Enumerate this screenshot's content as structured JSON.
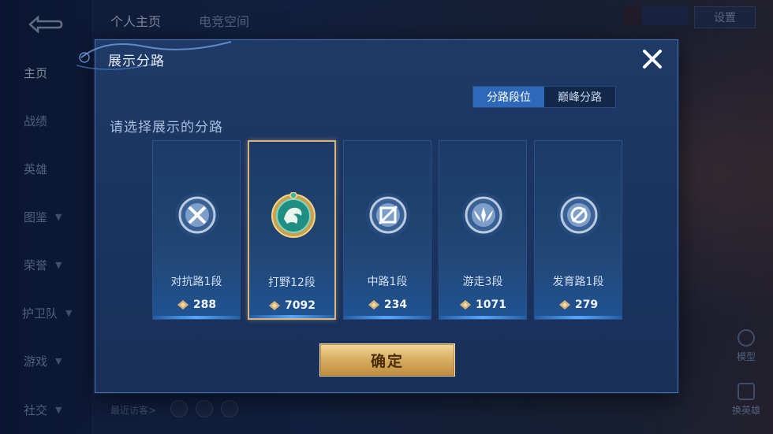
{
  "background": {
    "sidebar": {
      "items": [
        {
          "label": "主页",
          "chevron": false,
          "active": true
        },
        {
          "label": "战绩",
          "chevron": false,
          "active": false
        },
        {
          "label": "英雄",
          "chevron": false,
          "active": false
        },
        {
          "label": "图鉴",
          "chevron": true,
          "active": false
        },
        {
          "label": "荣誉",
          "chevron": true,
          "active": false
        },
        {
          "label": "护卫队",
          "chevron": true,
          "active": false
        },
        {
          "label": "游戏",
          "chevron": true,
          "active": false
        },
        {
          "label": "社交",
          "chevron": true,
          "active": false
        }
      ]
    },
    "top_tabs": [
      "个人主页",
      "电竞空间"
    ],
    "top_right_button": "设置",
    "right_buttons": [
      "模型",
      "换英雄"
    ],
    "recent_visitors_label": "最近访客>"
  },
  "dialog": {
    "title": "展示分路",
    "close_icon": "close-icon",
    "segment_tabs": [
      {
        "label": "分路段位",
        "selected": true
      },
      {
        "label": "巅峰分路",
        "selected": false
      }
    ],
    "subtitle": "请选择展示的分路",
    "cards": [
      {
        "name": "对抗路1段",
        "score": "288",
        "icon": "clash-lane-emblem",
        "selected": false
      },
      {
        "name": "打野12段",
        "score": "7092",
        "icon": "jungle-dragon-emblem",
        "selected": true
      },
      {
        "name": "中路1段",
        "score": "234",
        "icon": "mid-lane-emblem",
        "selected": false
      },
      {
        "name": "游走3段",
        "score": "1071",
        "icon": "roam-emblem",
        "selected": false
      },
      {
        "name": "发育路1段",
        "score": "279",
        "icon": "farm-lane-emblem",
        "selected": false
      }
    ],
    "confirm_label": "确定"
  },
  "colors": {
    "dialog_bg": "#1c3762",
    "accent_blue": "#2d68b9",
    "selected_border": "#d8b37a",
    "confirm_gold": "#d9b064"
  }
}
